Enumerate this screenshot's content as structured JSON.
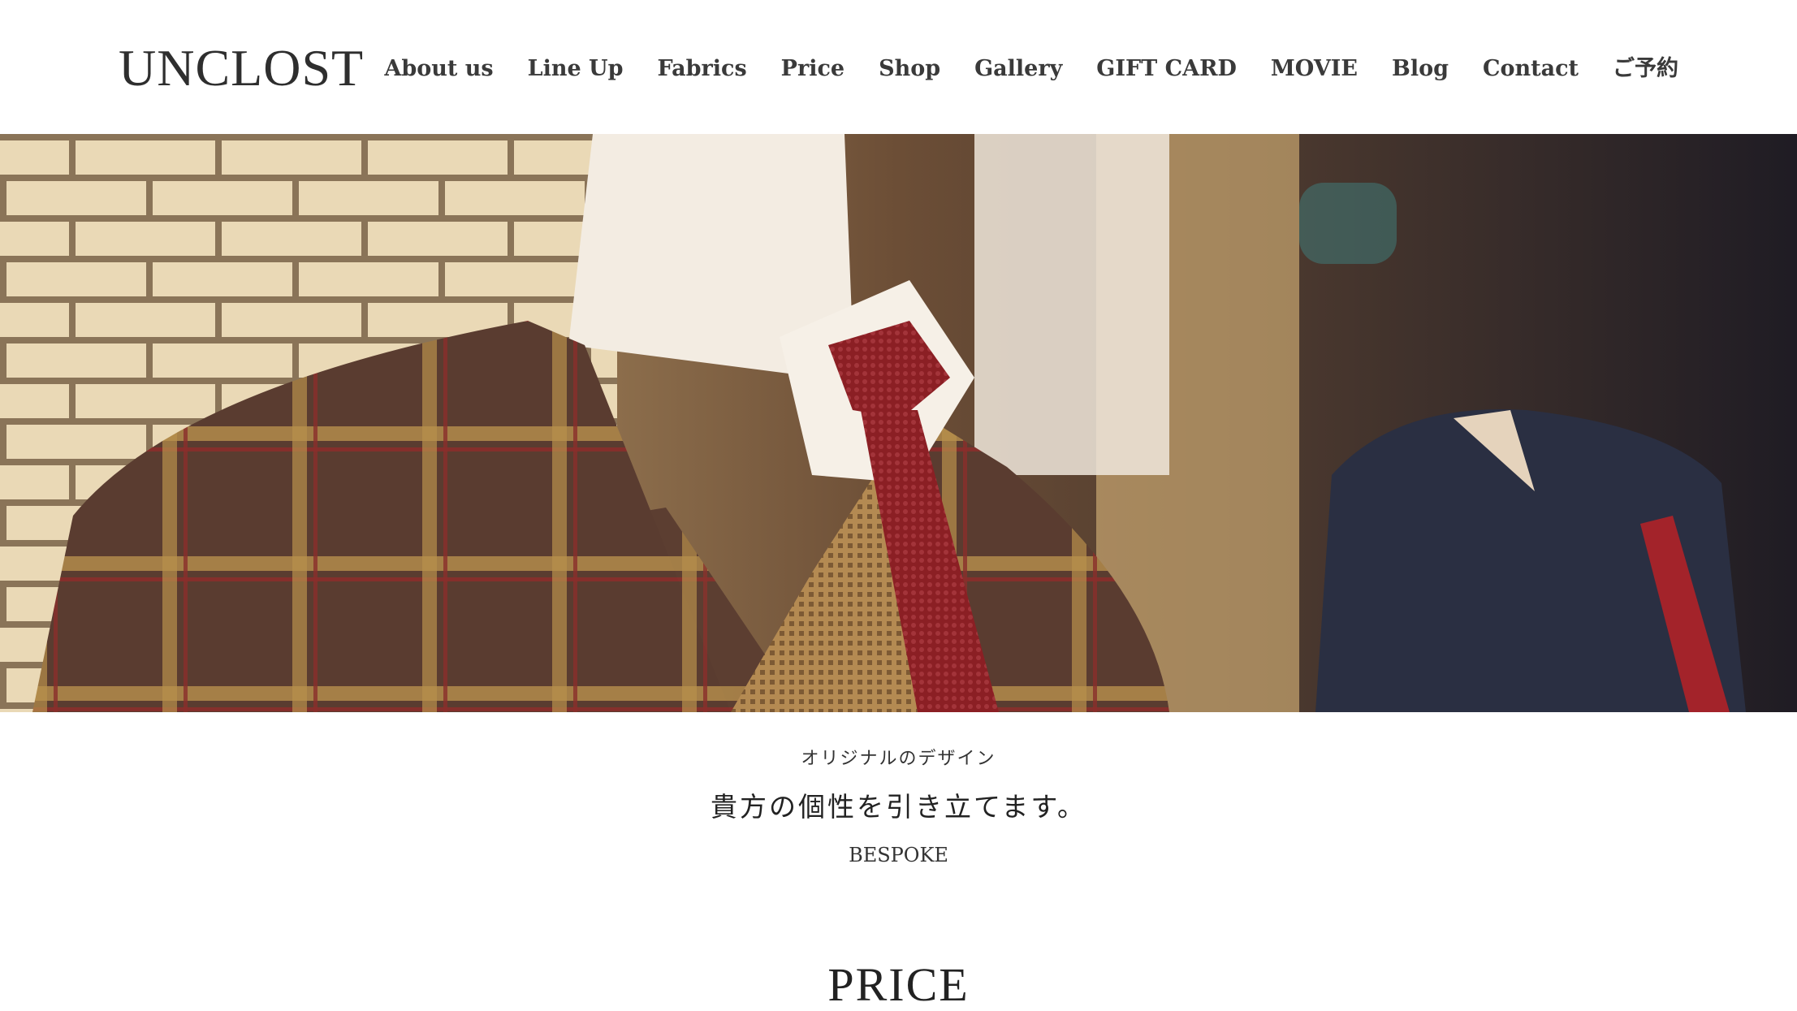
{
  "header": {
    "logo": "UNCLOST",
    "nav": [
      {
        "label": "About us"
      },
      {
        "label": "Line Up"
      },
      {
        "label": "Fabrics"
      },
      {
        "label": "Price"
      },
      {
        "label": "Shop"
      },
      {
        "label": "Gallery"
      },
      {
        "label": "GIFT CARD"
      },
      {
        "label": "MOVIE"
      },
      {
        "label": "Blog"
      },
      {
        "label": "Contact"
      },
      {
        "label": "ご予約"
      }
    ]
  },
  "hero": {
    "image_icon": "tailored-jacket-mannequin-photo"
  },
  "intro": {
    "subtitle": "オリジナルのデザイン",
    "headline": "貴方の個性を引き立てます。",
    "tag": "BESPOKE"
  },
  "section": {
    "title": "PRICE"
  },
  "colors": {
    "text": "#2b2b2b",
    "background": "#ffffff",
    "tie": "#8b1f24",
    "jacket": "#5a3b2e",
    "check": "#c79a4a"
  }
}
